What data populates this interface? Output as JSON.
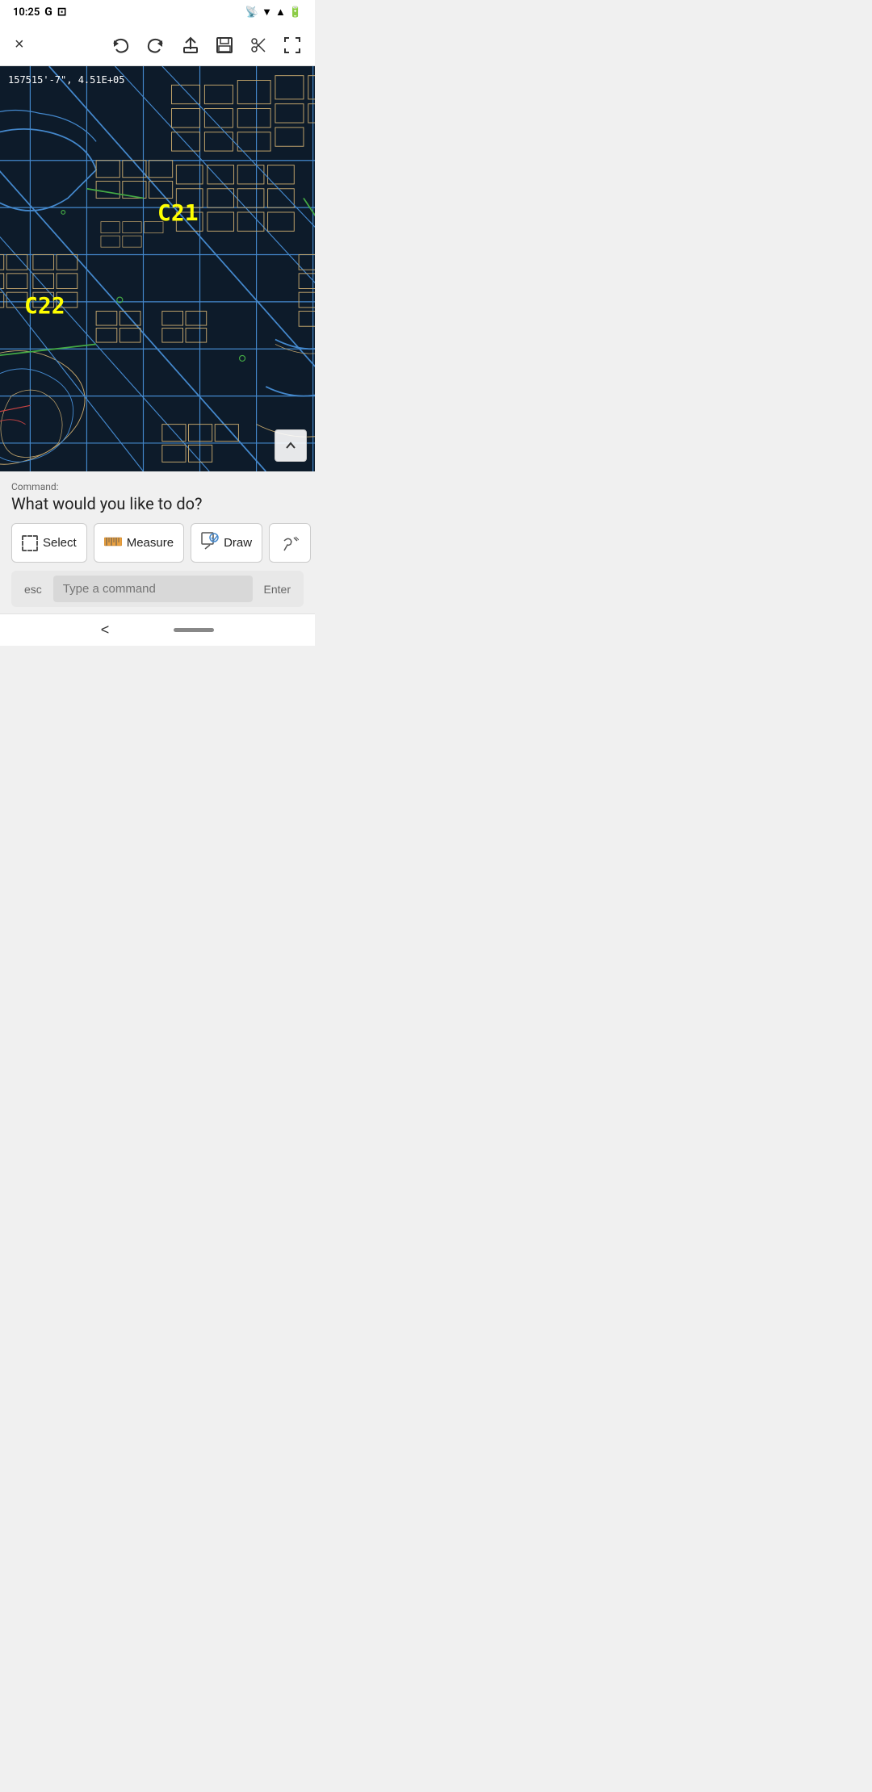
{
  "statusBar": {
    "time": "10:25",
    "googleIcon": "G",
    "castIcon": "⊡"
  },
  "toolbar": {
    "closeLabel": "×",
    "undoLabel": "⟵",
    "redoLabel": "⟶",
    "shareLabel": "↑",
    "saveLabel": "⊡",
    "scissorsLabel": "✂",
    "expandLabel": "⤢"
  },
  "map": {
    "coordinates": "157515'-7\", 4.51E+05",
    "labelC21": "C21",
    "labelC22": "C22",
    "expandBtnLabel": "^"
  },
  "commandArea": {
    "commandLabel": "Command:",
    "question": "What would you like to do?",
    "buttons": [
      {
        "id": "select",
        "label": "Select",
        "iconType": "select"
      },
      {
        "id": "measure",
        "label": "Measure",
        "iconType": "measure"
      },
      {
        "id": "draw",
        "label": "Draw",
        "iconType": "draw"
      }
    ],
    "moreBtnLabel": "…",
    "inputPlaceholder": "Type a command",
    "escLabel": "esc",
    "enterLabel": "Enter"
  },
  "bottomNav": {
    "backLabel": "<"
  }
}
